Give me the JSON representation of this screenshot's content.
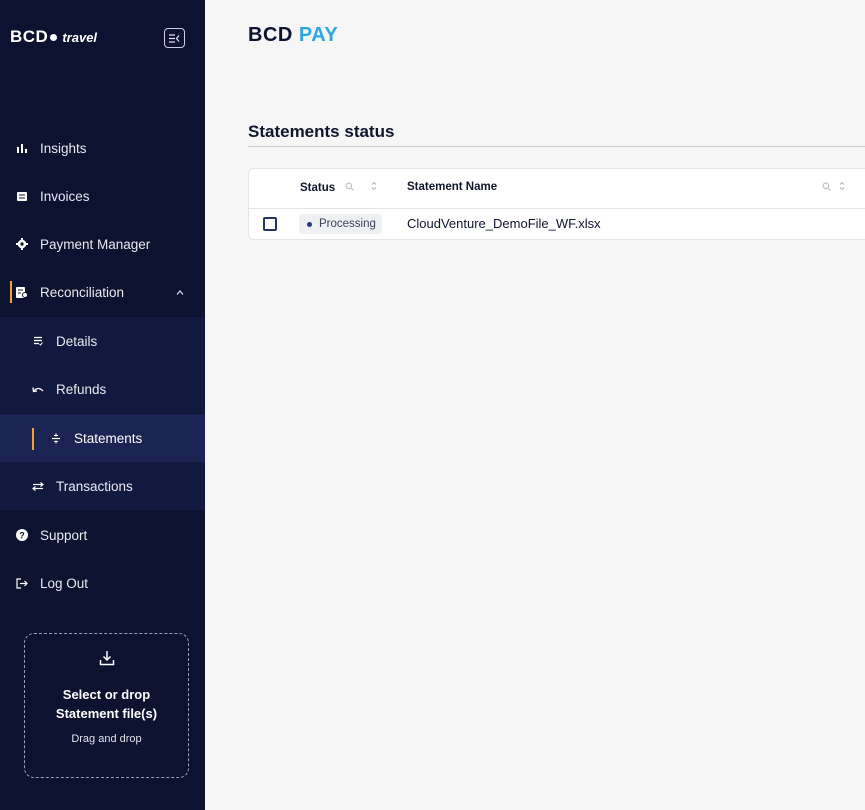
{
  "logo": {
    "brand": "BCD",
    "dots": "•••",
    "sub": "travel"
  },
  "colors": {
    "sidebar": "#0c1230",
    "accent": "#f0a238",
    "brand_pay": "#2ea7e0",
    "status_dot": "#1f3c78"
  },
  "nav": {
    "insights": "Insights",
    "invoices": "Invoices",
    "payment_manager": "Payment Manager",
    "reconciliation": "Reconciliation",
    "details": "Details",
    "refunds": "Refunds",
    "statements": "Statements",
    "transactions": "Transactions",
    "support": "Support",
    "logout": "Log Out"
  },
  "dropzone": {
    "title": "Select or drop Statement file(s)",
    "subtitle": "Drag and drop"
  },
  "header": {
    "brand_part1": "BCD",
    "brand_part2": "PAY"
  },
  "page": {
    "title": "Statements status"
  },
  "table": {
    "columns": [
      "Status",
      "Statement Name"
    ],
    "rows": [
      {
        "status": "Processing",
        "statement_name": "CloudVenture_DemoFile_WF.xlsx"
      }
    ]
  }
}
